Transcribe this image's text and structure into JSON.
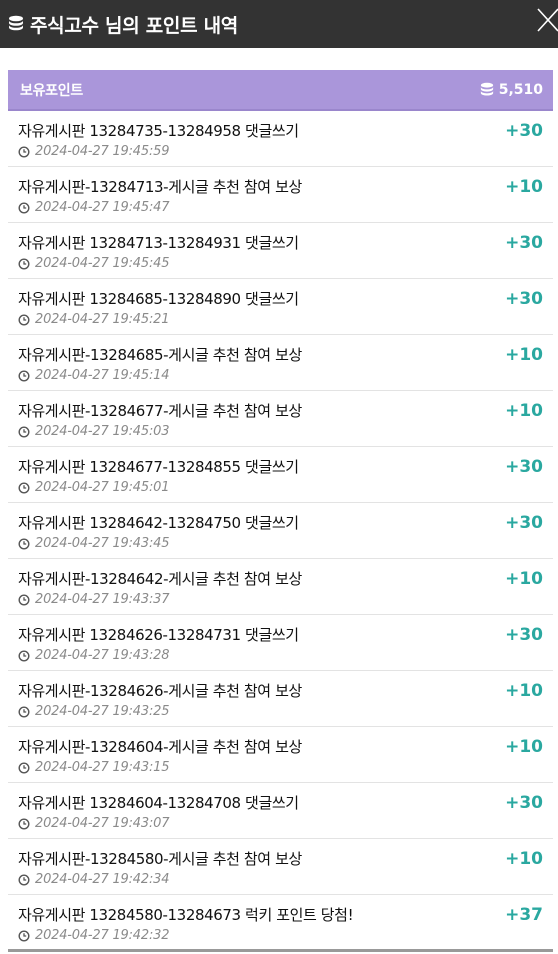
{
  "header": {
    "title": "주식고수 님의 포인트 내역",
    "icon": "database-icon",
    "close_icon": "close-icon",
    "background": "#333333"
  },
  "balance": {
    "label": "보유포인트",
    "value": "5,510",
    "background": "#aa96da"
  },
  "colors": {
    "amount": "#2aa8a0",
    "time": "#8a8a8a"
  },
  "history": [
    {
      "desc": "자유게시판 13284735-13284958 댓글쓰기",
      "time": "2024-04-27 19:45:59",
      "amount": "+30"
    },
    {
      "desc": "자유게시판-13284713-게시글 추천 참여 보상",
      "time": "2024-04-27 19:45:47",
      "amount": "+10"
    },
    {
      "desc": "자유게시판 13284713-13284931 댓글쓰기",
      "time": "2024-04-27 19:45:45",
      "amount": "+30"
    },
    {
      "desc": "자유게시판 13284685-13284890 댓글쓰기",
      "time": "2024-04-27 19:45:21",
      "amount": "+30"
    },
    {
      "desc": "자유게시판-13284685-게시글 추천 참여 보상",
      "time": "2024-04-27 19:45:14",
      "amount": "+10"
    },
    {
      "desc": "자유게시판-13284677-게시글 추천 참여 보상",
      "time": "2024-04-27 19:45:03",
      "amount": "+10"
    },
    {
      "desc": "자유게시판 13284677-13284855 댓글쓰기",
      "time": "2024-04-27 19:45:01",
      "amount": "+30"
    },
    {
      "desc": "자유게시판 13284642-13284750 댓글쓰기",
      "time": "2024-04-27 19:43:45",
      "amount": "+30"
    },
    {
      "desc": "자유게시판-13284642-게시글 추천 참여 보상",
      "time": "2024-04-27 19:43:37",
      "amount": "+10"
    },
    {
      "desc": "자유게시판 13284626-13284731 댓글쓰기",
      "time": "2024-04-27 19:43:28",
      "amount": "+30"
    },
    {
      "desc": "자유게시판-13284626-게시글 추천 참여 보상",
      "time": "2024-04-27 19:43:25",
      "amount": "+10"
    },
    {
      "desc": "자유게시판-13284604-게시글 추천 참여 보상",
      "time": "2024-04-27 19:43:15",
      "amount": "+10"
    },
    {
      "desc": "자유게시판 13284604-13284708 댓글쓰기",
      "time": "2024-04-27 19:43:07",
      "amount": "+30"
    },
    {
      "desc": "자유게시판-13284580-게시글 추천 참여 보상",
      "time": "2024-04-27 19:42:34",
      "amount": "+10"
    },
    {
      "desc": "자유게시판 13284580-13284673 럭키 포인트 당첨!",
      "time": "2024-04-27 19:42:32",
      "amount": "+37"
    }
  ]
}
